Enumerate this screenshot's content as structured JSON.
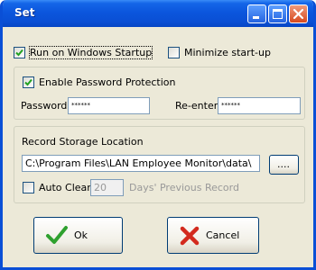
{
  "window": {
    "title": "Set"
  },
  "options": {
    "run_on_startup": {
      "label": "Run on Windows Startup",
      "checked": true
    },
    "minimize_startup": {
      "label": "Minimize start-up",
      "checked": false
    }
  },
  "password": {
    "enable_label": "Enable Password Protection",
    "enabled": true,
    "password_label": "Password",
    "password_value": "******",
    "reenter_label": "Re-enter",
    "reenter_value": "******"
  },
  "storage": {
    "section_label": "Record Storage Location",
    "path_value": "C:\\Program Files\\LAN Employee Monitor\\data\\",
    "browse_label": "....",
    "auto_clear_label": "Auto Clear",
    "auto_clear_checked": false,
    "days_value": "20",
    "days_suffix": "Days' Previous Record"
  },
  "buttons": {
    "ok_label": "Ok",
    "cancel_label": "Cancel"
  },
  "colors": {
    "titlebar": "#0a4fd6",
    "dialog_bg": "#ece9d8",
    "ok_check": "#2fa12f",
    "cancel_x": "#d32a1e"
  }
}
